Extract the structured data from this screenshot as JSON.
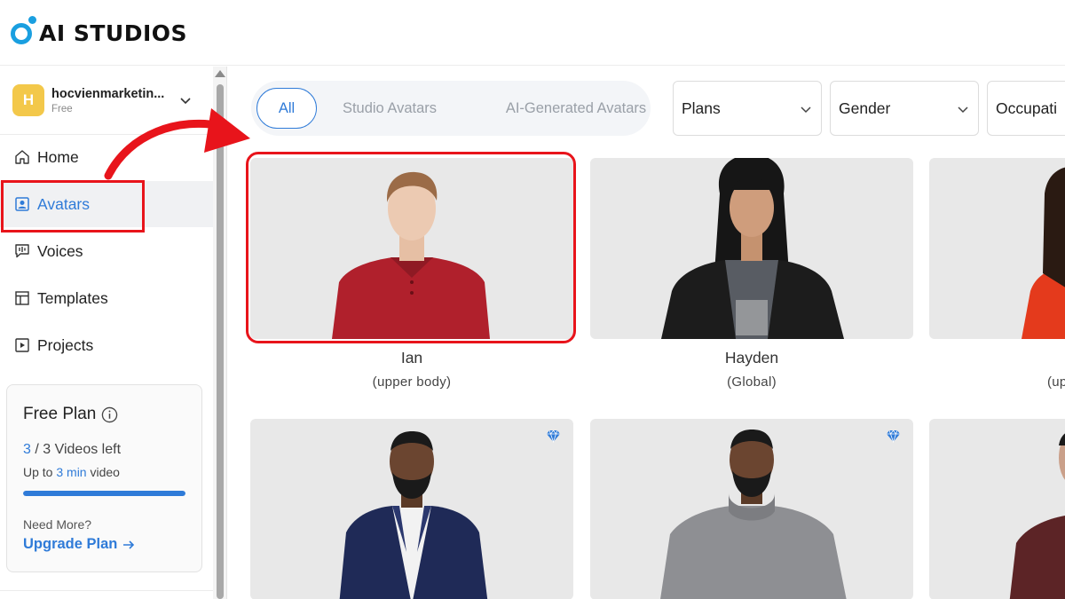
{
  "app": {
    "logo_text": "AI STUDIOS"
  },
  "account": {
    "initial": "H",
    "name": "hocvienmarketin...",
    "plan": "Free"
  },
  "nav": {
    "home": "Home",
    "avatars": "Avatars",
    "voices": "Voices",
    "templates": "Templates",
    "projects": "Projects"
  },
  "plan_card": {
    "title": "Free Plan",
    "videos_used": "3",
    "videos_total_text": "/ 3 Videos left",
    "duration_prefix": "Up to",
    "duration_value": "3 min",
    "duration_suffix": "video",
    "progress_fraction": 1.0,
    "need_more": "Need More?",
    "upgrade": "Upgrade Plan"
  },
  "filters": {
    "tabs": [
      "All",
      "Studio Avatars",
      "AI-Generated Avatars"
    ],
    "active_tab": "All",
    "dropdowns": {
      "plans": "Plans",
      "gender": "Gender",
      "occupation": "Occupati"
    }
  },
  "avatars": [
    {
      "name": "Ian",
      "subtitle": "(upper body)"
    },
    {
      "name": "Hayden",
      "subtitle": "(Global)"
    },
    {
      "name": "",
      "subtitle": "(up"
    }
  ],
  "colors": {
    "accent": "#2f7bd8",
    "highlight": "#e8141b",
    "logo": "#1a9fe0",
    "account_avatar": "#f3c84a"
  }
}
